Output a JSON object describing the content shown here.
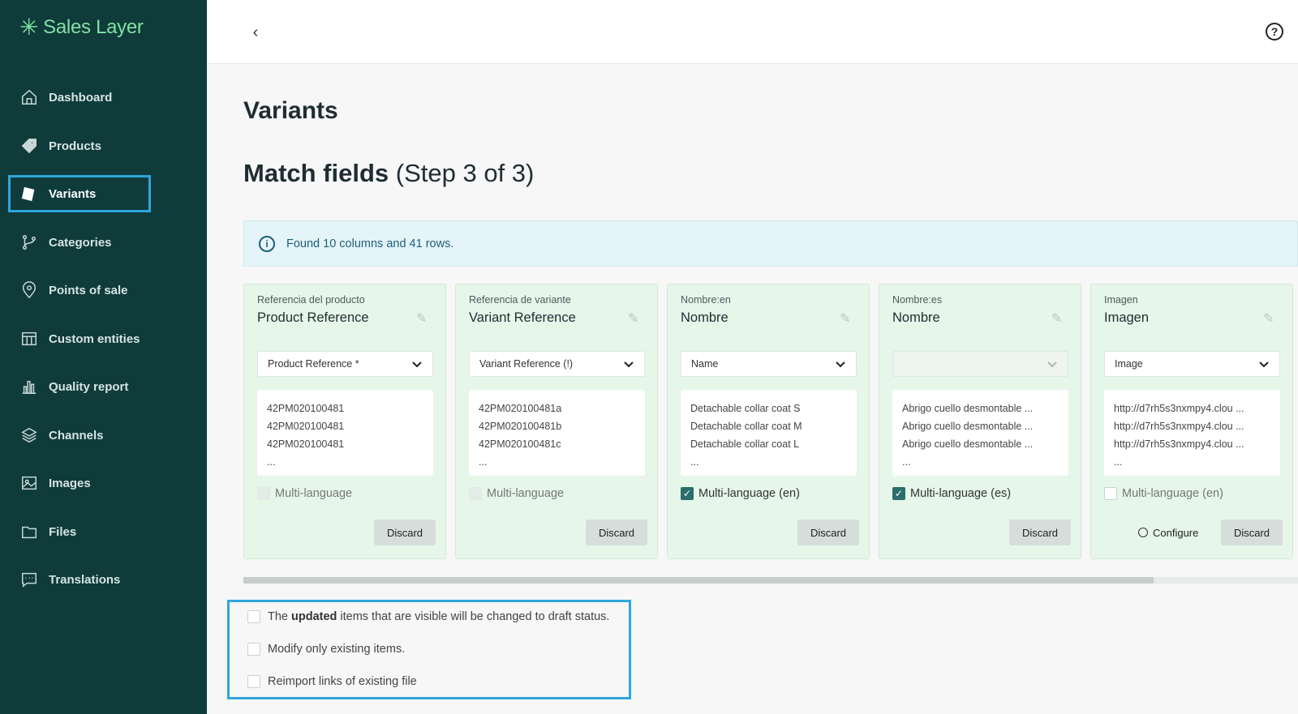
{
  "app": {
    "name": "Sales Layer"
  },
  "sidebar": {
    "items": [
      {
        "label": "Dashboard",
        "icon": "home-icon"
      },
      {
        "label": "Products",
        "icon": "tag-icon"
      },
      {
        "label": "Variants",
        "icon": "variants-icon",
        "active": true
      },
      {
        "label": "Categories",
        "icon": "branch-icon"
      },
      {
        "label": "Points of sale",
        "icon": "location-pin-icon"
      },
      {
        "label": "Custom entities",
        "icon": "table-icon"
      },
      {
        "label": "Quality report",
        "icon": "bar-chart-icon"
      },
      {
        "label": "Channels",
        "icon": "layers-icon"
      },
      {
        "label": "Images",
        "icon": "image-icon"
      },
      {
        "label": "Files",
        "icon": "folder-icon"
      },
      {
        "label": "Translations",
        "icon": "chat-icon"
      }
    ]
  },
  "header": {
    "back": "‹",
    "help": "?"
  },
  "page": {
    "title": "Variants",
    "step_title_bold": "Match fields",
    "step_title_rest": "(Step 3 of 3)",
    "info": "Found 10 columns and 41 rows."
  },
  "cards": [
    {
      "sub": "Referencia del producto",
      "main": "Product Reference",
      "select": "Product Reference *",
      "preview": [
        "42PM020100481",
        "42PM020100481",
        "42PM020100481",
        "..."
      ],
      "ml_label": "Multi-language",
      "ml_state": "disabled",
      "discard": "Discard"
    },
    {
      "sub": "Referencia de variante",
      "main": "Variant Reference",
      "select": "Variant Reference (!)",
      "preview": [
        "42PM020100481a",
        "42PM020100481b",
        "42PM020100481c",
        "..."
      ],
      "ml_label": "Multi-language",
      "ml_state": "disabled",
      "discard": "Discard"
    },
    {
      "sub": "Nombre:en",
      "main": "Nombre",
      "select": "Name",
      "preview": [
        "Detachable collar coat S",
        "Detachable collar coat M",
        "Detachable collar coat L",
        "..."
      ],
      "ml_label": "Multi-language (en)",
      "ml_state": "checked",
      "discard": "Discard"
    },
    {
      "sub": "Nombre:es",
      "main": "Nombre",
      "select": "",
      "preview": [
        "Abrigo cuello desmontable ...",
        "Abrigo cuello desmontable ...",
        "Abrigo cuello desmontable ...",
        "..."
      ],
      "ml_label": "Multi-language (es)",
      "ml_state": "checked",
      "discard": "Discard"
    },
    {
      "sub": "Imagen",
      "main": "Imagen",
      "select": "Image",
      "preview": [
        "http://d7rh5s3nxmpy4.clou ...",
        "http://d7rh5s3nxmpy4.clou ...",
        "http://d7rh5s3nxmpy4.clou ...",
        "..."
      ],
      "ml_label": "Multi-language (en)",
      "ml_state": "unchecked",
      "configure": "Configure",
      "discard": "Discard"
    }
  ],
  "options": {
    "opt1_pre": "The",
    "opt1_bold": "updated",
    "opt1_post": "items that are visible will be changed to draft status.",
    "opt2": "Modify only existing items.",
    "opt3": "Reimport links of existing file"
  },
  "colors": {
    "sidebar_bg": "#0f3b3b",
    "accent": "#7fe3a3",
    "highlight": "#2fa6dc",
    "card_bg": "#e6f6e9"
  }
}
